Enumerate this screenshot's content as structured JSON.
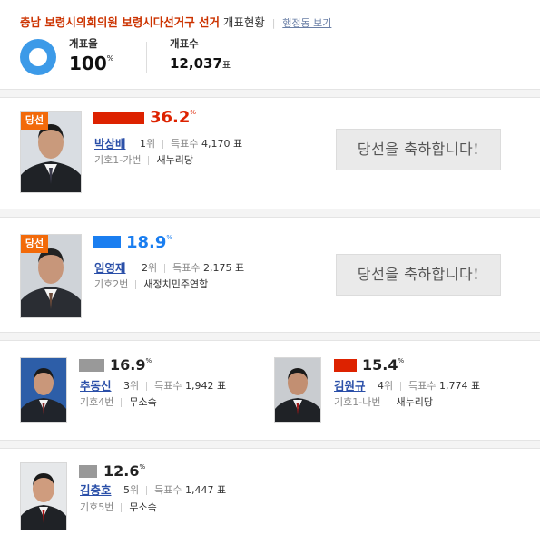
{
  "header": {
    "title": "충남 보령시의회의원 보령시다선거구 선거",
    "suffix": "개표현황",
    "link": "행정동 보기"
  },
  "summary": {
    "rate_label": "개표율",
    "rate_value": "100",
    "rate_unit": "%",
    "rate_fraction": 1.0,
    "count_label": "개표수",
    "count_value": "12,037",
    "count_unit": "표"
  },
  "colors": {
    "winner_red": "#dd2200",
    "winner_blue": "#1a7ef0",
    "gray": "#999999",
    "red_party": "#dd2200",
    "donut": "#3c9ae8",
    "winner_tag": "#f26a0a",
    "name_link": "#2a4fa8"
  },
  "labels": {
    "rank_suffix": "위",
    "votes_label": "득표수",
    "votes_unit": "표",
    "percent_unit": "%",
    "winner_tag": "당선",
    "congrats": "당선을 축하합니다!"
  },
  "candidates": [
    {
      "name": "박상배",
      "rank": "1",
      "votes": "4,170",
      "percent": "36.2",
      "number": "기호1-가번",
      "party": "새누리당",
      "winner": true,
      "bar_color": "#dd2200"
    },
    {
      "name": "임영재",
      "rank": "2",
      "votes": "2,175",
      "percent": "18.9",
      "number": "기호2번",
      "party": "새정치민주연합",
      "winner": true,
      "bar_color": "#1a7ef0"
    },
    {
      "name": "추동신",
      "rank": "3",
      "votes": "1,942",
      "percent": "16.9",
      "number": "기호4번",
      "party": "무소속",
      "winner": false,
      "bar_color": "#999999"
    },
    {
      "name": "김원규",
      "rank": "4",
      "votes": "1,774",
      "percent": "15.4",
      "number": "기호1-나번",
      "party": "새누리당",
      "winner": false,
      "bar_color": "#dd2200"
    },
    {
      "name": "김충호",
      "rank": "5",
      "votes": "1,447",
      "percent": "12.6",
      "number": "기호5번",
      "party": "무소속",
      "winner": false,
      "bar_color": "#999999"
    }
  ]
}
